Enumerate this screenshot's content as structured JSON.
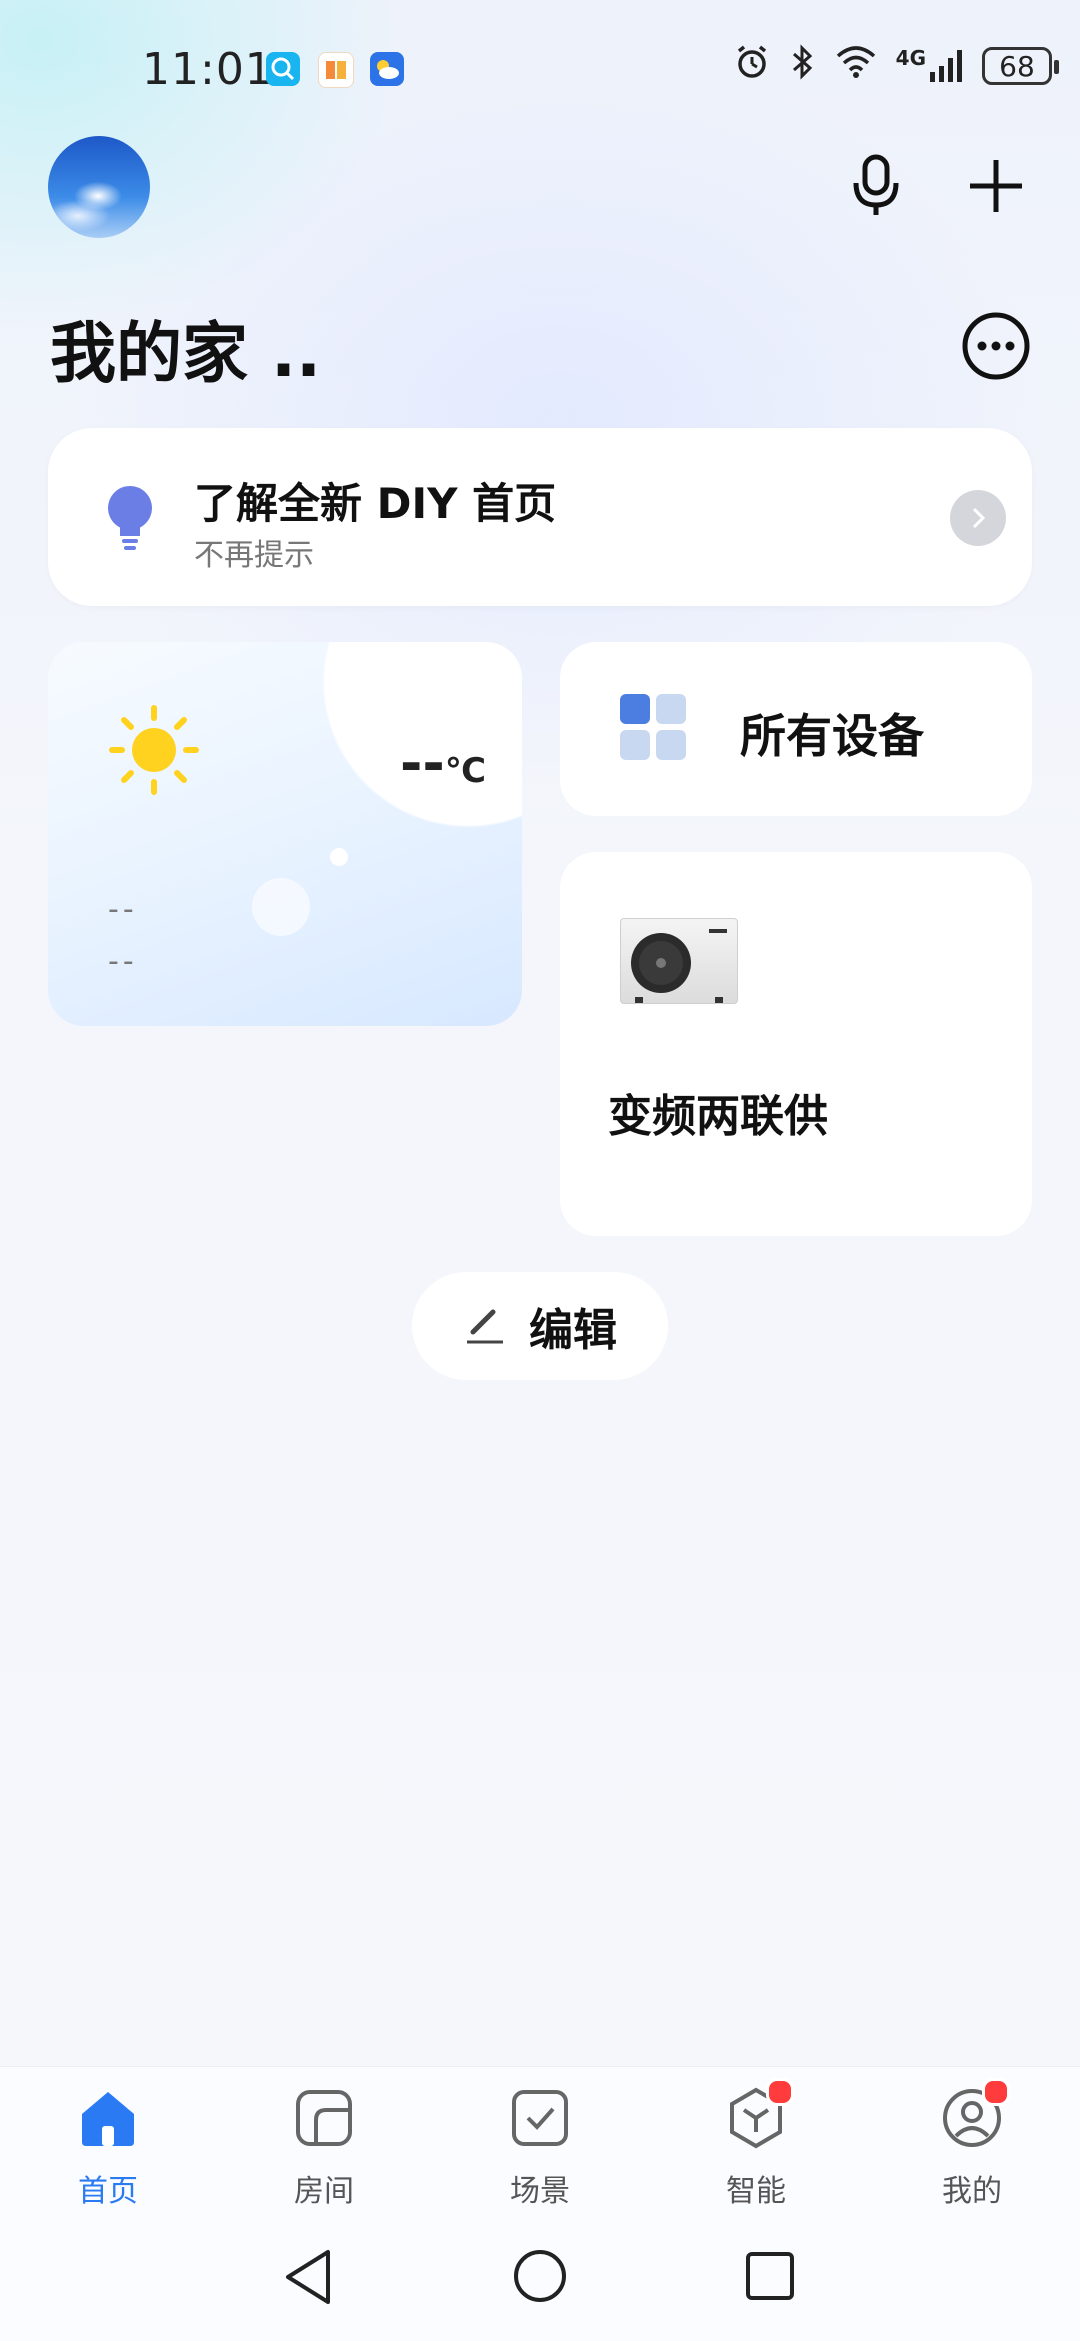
{
  "status_bar": {
    "time": "11:01",
    "network": "4G",
    "battery": "68"
  },
  "header": {
    "title": "我的家 .."
  },
  "banner": {
    "title": "了解全新 DIY 首页",
    "subtitle": "不再提示"
  },
  "weather": {
    "temperature": "--",
    "unit": "℃",
    "line1": "--",
    "line2": "--"
  },
  "cards": {
    "all_devices": "所有设备",
    "device_name": "变频两联供"
  },
  "edit": {
    "label": "编辑"
  },
  "bottom_nav": {
    "items": [
      {
        "label": "首页",
        "icon": "home-icon",
        "active": true
      },
      {
        "label": "房间",
        "icon": "room-icon"
      },
      {
        "label": "场景",
        "icon": "scene-icon"
      },
      {
        "label": "智能",
        "icon": "smart-icon",
        "badge": true
      },
      {
        "label": "我的",
        "icon": "profile-icon",
        "badge": true
      }
    ]
  },
  "colors": {
    "accent": "#2a7bf3",
    "badge": "#ff3b3b",
    "bulb": "#6b7ee6"
  }
}
